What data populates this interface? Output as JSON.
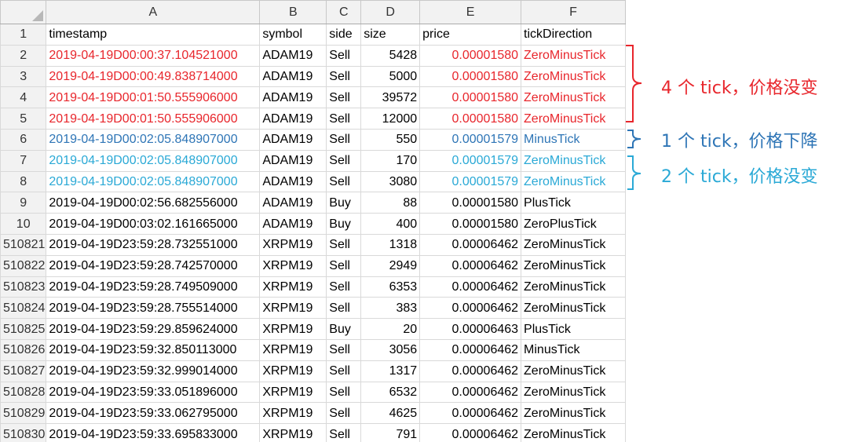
{
  "columns": {
    "letters": [
      "A",
      "B",
      "C",
      "D",
      "E",
      "F"
    ]
  },
  "rows": [
    {
      "num": "1",
      "cells": [
        "timestamp",
        "symbol",
        "side",
        "size",
        "price",
        "tickDirection"
      ]
    },
    {
      "num": "2",
      "cells": [
        "2019-04-19D00:00:37.104521000",
        "ADAM19",
        "Sell",
        "5428",
        "0.00001580",
        "ZeroMinusTick"
      ]
    },
    {
      "num": "3",
      "cells": [
        "2019-04-19D00:00:49.838714000",
        "ADAM19",
        "Sell",
        "5000",
        "0.00001580",
        "ZeroMinusTick"
      ]
    },
    {
      "num": "4",
      "cells": [
        "2019-04-19D00:01:50.555906000",
        "ADAM19",
        "Sell",
        "39572",
        "0.00001580",
        "ZeroMinusTick"
      ]
    },
    {
      "num": "5",
      "cells": [
        "2019-04-19D00:01:50.555906000",
        "ADAM19",
        "Sell",
        "12000",
        "0.00001580",
        "ZeroMinusTick"
      ]
    },
    {
      "num": "6",
      "cells": [
        "2019-04-19D00:02:05.848907000",
        "ADAM19",
        "Sell",
        "550",
        "0.00001579",
        "MinusTick"
      ]
    },
    {
      "num": "7",
      "cells": [
        "2019-04-19D00:02:05.848907000",
        "ADAM19",
        "Sell",
        "170",
        "0.00001579",
        "ZeroMinusTick"
      ]
    },
    {
      "num": "8",
      "cells": [
        "2019-04-19D00:02:05.848907000",
        "ADAM19",
        "Sell",
        "3080",
        "0.00001579",
        "ZeroMinusTick"
      ]
    },
    {
      "num": "9",
      "cells": [
        "2019-04-19D00:02:56.682556000",
        "ADAM19",
        "Buy",
        "88",
        "0.00001580",
        "PlusTick"
      ]
    },
    {
      "num": "10",
      "cells": [
        "2019-04-19D00:03:02.161665000",
        "ADAM19",
        "Buy",
        "400",
        "0.00001580",
        "ZeroPlusTick"
      ]
    },
    {
      "num": "510821",
      "cells": [
        "2019-04-19D23:59:28.732551000",
        "XRPM19",
        "Sell",
        "1318",
        "0.00006462",
        "ZeroMinusTick"
      ]
    },
    {
      "num": "510822",
      "cells": [
        "2019-04-19D23:59:28.742570000",
        "XRPM19",
        "Sell",
        "2949",
        "0.00006462",
        "ZeroMinusTick"
      ]
    },
    {
      "num": "510823",
      "cells": [
        "2019-04-19D23:59:28.749509000",
        "XRPM19",
        "Sell",
        "6353",
        "0.00006462",
        "ZeroMinusTick"
      ]
    },
    {
      "num": "510824",
      "cells": [
        "2019-04-19D23:59:28.755514000",
        "XRPM19",
        "Sell",
        "383",
        "0.00006462",
        "ZeroMinusTick"
      ]
    },
    {
      "num": "510825",
      "cells": [
        "2019-04-19D23:59:29.859624000",
        "XRPM19",
        "Buy",
        "20",
        "0.00006463",
        "PlusTick"
      ]
    },
    {
      "num": "510826",
      "cells": [
        "2019-04-19D23:59:32.850113000",
        "XRPM19",
        "Sell",
        "3056",
        "0.00006462",
        "MinusTick"
      ]
    },
    {
      "num": "510827",
      "cells": [
        "2019-04-19D23:59:32.999014000",
        "XRPM19",
        "Sell",
        "1317",
        "0.00006462",
        "ZeroMinusTick"
      ]
    },
    {
      "num": "510828",
      "cells": [
        "2019-04-19D23:59:33.051896000",
        "XRPM19",
        "Sell",
        "6532",
        "0.00006462",
        "ZeroMinusTick"
      ]
    },
    {
      "num": "510829",
      "cells": [
        "2019-04-19D23:59:33.062795000",
        "XRPM19",
        "Sell",
        "4625",
        "0.00006462",
        "ZeroMinusTick"
      ]
    },
    {
      "num": "510830",
      "cells": [
        "2019-04-19D23:59:33.695833000",
        "XRPM19",
        "Sell",
        "791",
        "0.00006462",
        "ZeroMinusTick"
      ]
    }
  ],
  "annotations": {
    "red_label": "4 个 tick，价格没变",
    "blue_label": "1 个 tick，价格下降",
    "cyan_label": "2 个 tick，价格没变"
  },
  "colors": {
    "red": "#e8262c",
    "blue": "#2e75b6",
    "cyan": "#2aa9d6"
  }
}
